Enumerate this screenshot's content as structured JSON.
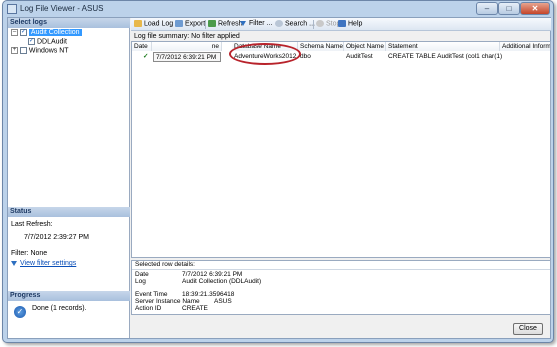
{
  "window": {
    "title": "Log File Viewer - ASUS"
  },
  "left": {
    "select_logs_header": "Select logs",
    "tree": [
      {
        "label": "Audit Collection",
        "checked": true
      },
      {
        "label": "DDLAudit",
        "checked": true
      },
      {
        "label": "Windows NT",
        "checked": false
      }
    ],
    "status_header": "Status",
    "last_refresh_label": "Last Refresh:",
    "last_refresh_value": "7/7/2012 2:39:27 PM",
    "filter_text": "Filter: None",
    "view_filter_link": "View filter settings",
    "progress_header": "Progress",
    "progress_text": "Done (1 records)."
  },
  "toolbar": {
    "load_log": "Load Log",
    "export": "Export",
    "refresh": "Refresh",
    "filter": "Filter ...",
    "search": "Search ...",
    "stop": "Stop",
    "help": "Help"
  },
  "grid": {
    "summary": "Log file summary: No filter applied",
    "columns": [
      "Date",
      "ne",
      "Database Name",
      "Schema Name",
      "Object Name",
      "Statement",
      "Additional Information"
    ],
    "row": {
      "date": "7/7/2012 6:39:21 PM",
      "database": "AdventureWorks2012",
      "schema": "dbo",
      "object": "AuditTest",
      "statement": "CREATE TABLE AuditTest (col1 char(1));"
    }
  },
  "details": {
    "header": "Selected row details:",
    "rows": [
      {
        "label": "Date",
        "value": "7/7/2012 6:39:21 PM"
      },
      {
        "label": "Log",
        "value": "Audit Collection (DDLAudit)"
      },
      {
        "label": "",
        "value": ""
      },
      {
        "label": "Event Time",
        "value": "18:39:21.3596418"
      },
      {
        "label": "Server Instance Name",
        "value": "ASUS"
      },
      {
        "label": "Action ID",
        "value": "CREATE"
      }
    ]
  },
  "footer": {
    "close_label": "Close"
  },
  "colors": {
    "accent": "#3399ff",
    "highlight_oval": "#b8232b"
  }
}
